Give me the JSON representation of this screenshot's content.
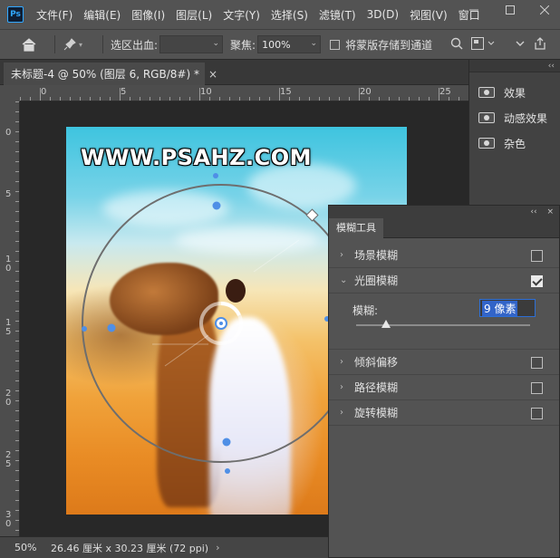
{
  "app": {
    "logo": "Ps"
  },
  "menu": [
    "文件(F)",
    "编辑(E)",
    "图像(I)",
    "图层(L)",
    "文字(Y)",
    "选择(S)",
    "滤镜(T)",
    "3D(D)",
    "视图(V)",
    "窗口"
  ],
  "options": {
    "bleed_label": "选区出血:",
    "bleed_value": "",
    "focus_label": "聚焦:",
    "focus_value": "100%",
    "save_mask_label": "将蒙版存储到通道"
  },
  "document": {
    "tab_title": "未标题-4 @ 50% (图层 6, RGB/8#) *",
    "watermark": "WWW.PSAHZ.COM"
  },
  "rulers": {
    "horizontal": [
      "5",
      "0",
      "5",
      "10",
      "15",
      "20",
      "25"
    ],
    "vertical": [
      "0",
      "5",
      "1\n0",
      "1\n5",
      "2\n0",
      "2\n5",
      "3\n0"
    ]
  },
  "effects_panel": {
    "items": [
      {
        "label": "效果",
        "icon": "eye-icon"
      },
      {
        "label": "动感效果",
        "icon": "eye-icon"
      },
      {
        "label": "杂色",
        "icon": "eye-icon"
      }
    ]
  },
  "blur_panel": {
    "tab": "模糊工具",
    "sections": [
      {
        "label": "场景模糊",
        "expanded": false,
        "checked": false
      },
      {
        "label": "光圈模糊",
        "expanded": true,
        "checked": true
      },
      {
        "label": "倾斜偏移",
        "expanded": false,
        "checked": false
      },
      {
        "label": "路径模糊",
        "expanded": false,
        "checked": false
      },
      {
        "label": "旋转模糊",
        "expanded": false,
        "checked": false
      }
    ],
    "blur_label": "模糊:",
    "blur_value": "9 像素",
    "blur_slider_fraction": 0.17
  },
  "status": {
    "zoom": "50%",
    "doc_info": "26.46 厘米 x 30.23 厘米 (72 ppi)"
  },
  "colors": {
    "accent_blue": "#4f8fe6",
    "selection_blue": "#3264c8"
  }
}
